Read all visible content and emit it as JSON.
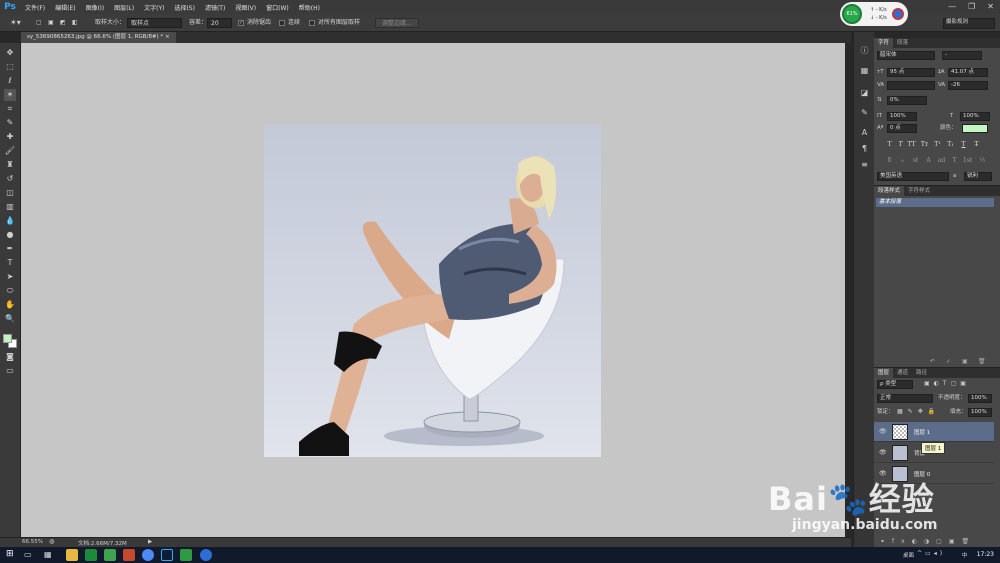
{
  "app": {
    "logo": "Ps"
  },
  "menu": [
    "文件(F)",
    "编辑(E)",
    "图像(I)",
    "图层(L)",
    "文字(Y)",
    "选择(S)",
    "滤镜(T)",
    "视图(V)",
    "窗口(W)",
    "帮助(H)"
  ],
  "window_controls": {
    "minimize": "—",
    "restore": "❐",
    "close": "✕"
  },
  "options": {
    "sample_size_label": "取样大小：",
    "sample_size_value": "取样点",
    "tolerance_label": "容差：",
    "tolerance_value": "20",
    "antialias_label": "消除锯齿",
    "contiguous_label": "连续",
    "sample_all_label": "对所有图层取样",
    "refine_edge": "调整边缘..."
  },
  "speed_widget": {
    "percent": "61%",
    "up": "↑  -  K/s",
    "down": "↓  -  K/s"
  },
  "workspace": "摄影规则",
  "document_tab": "sy_53690865263.jpg @ 66.6% (图层 1, RGB/8#) *  ×",
  "status": {
    "zoom": "66.55%",
    "doc": "文档:2.66M/7.32M"
  },
  "character": {
    "tabs": [
      "字符",
      "段落"
    ],
    "font_family": "腊宋体",
    "font_style": "-",
    "size": "95 点",
    "leading": "41.07 点",
    "kerning": "",
    "tracking": "-26",
    "scale_label": "0%",
    "vscale": "100%",
    "hscale": "100%",
    "baseline": "0 点",
    "color_label": "颜色：",
    "color_hex": "#c4f7c4",
    "type_buttons": [
      "T",
      "T",
      "TT",
      "Tт",
      "T¹",
      "T₁",
      "T",
      "T̶"
    ],
    "feature_buttons": [
      "fi",
      "ℴ",
      "st",
      "A",
      "ad",
      "T",
      "1st",
      "½"
    ],
    "language": "美国英语",
    "antialias": "锐利",
    "aa_badge": "a"
  },
  "paragraph_styles": {
    "tabs": [
      "段落样式",
      "字符样式"
    ],
    "item": "基本段落"
  },
  "layers": {
    "tabs": [
      "图层",
      "通道",
      "路径"
    ],
    "filter": "ρ 类型",
    "blend_mode": "正常",
    "opacity_label": "不透明度：",
    "opacity": "100%",
    "lock_label": "锁定：",
    "fill_label": "填充：",
    "fill": "100%",
    "rows": [
      {
        "name": "图层 1",
        "selected": true
      },
      {
        "name": "背景",
        "selected": false
      },
      {
        "name": "图层 0",
        "selected": false
      }
    ],
    "tooltip": "图层 1"
  },
  "watermark": {
    "brand": "Bai🐾经验",
    "url": "jingyan.baidu.com"
  },
  "taskbar": {
    "desktop_label": "桌面",
    "ime": "中",
    "time": "17:23"
  }
}
